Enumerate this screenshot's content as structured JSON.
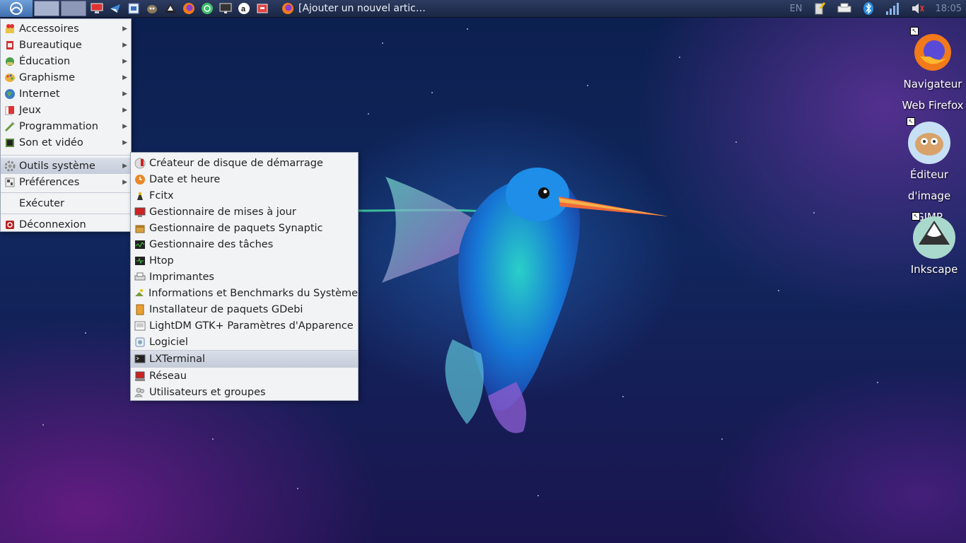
{
  "taskbar": {
    "task_title": "[Ajouter un nouvel artic…",
    "language": "EN",
    "clock": "18:05",
    "launchers": [
      "computer-icon",
      "mail-icon",
      "files-icon",
      "gimp-icon",
      "inkscape-icon",
      "firefox-icon",
      "software-icon",
      "monitor-icon",
      "amazon-icon",
      "archive-icon"
    ]
  },
  "main_menu": {
    "categories": [
      {
        "label": "Accessoires",
        "icon": "accessories-icon"
      },
      {
        "label": "Bureautique",
        "icon": "office-icon"
      },
      {
        "label": "Éducation",
        "icon": "education-icon"
      },
      {
        "label": "Graphisme",
        "icon": "graphics-icon"
      },
      {
        "label": "Internet",
        "icon": "internet-icon"
      },
      {
        "label": "Jeux",
        "icon": "games-icon"
      },
      {
        "label": "Programmation",
        "icon": "programming-icon"
      },
      {
        "label": "Son et vidéo",
        "icon": "multimedia-icon"
      }
    ],
    "system_tools": "Outils système",
    "preferences": "Préférences",
    "run": "Exécuter",
    "logout": "Déconnexion"
  },
  "submenu": {
    "items": [
      "Créateur de disque de démarrage",
      "Date et heure",
      "Fcitx",
      "Gestionnaire de mises à jour",
      "Gestionnaire de paquets Synaptic",
      "Gestionnaire des tâches",
      "Htop",
      "Imprimantes",
      "Informations et Benchmarks du Système",
      "Installateur de paquets GDebi",
      "LightDM GTK+ Paramètres d'Apparence",
      "Logiciel",
      "LXTerminal",
      "Réseau",
      "Utilisateurs et groupes"
    ],
    "highlighted": "LXTerminal"
  },
  "desktop": {
    "firefox": [
      "Navigateur",
      "Web Firefox"
    ],
    "gimp": [
      "Éditeur",
      "d'image GIMP"
    ],
    "inkscape": [
      "Inkscape"
    ]
  },
  "colors": {
    "taskbar": "#1b2644",
    "menu_bg": "#f2f3f5",
    "highlight": "#c5ccda"
  }
}
